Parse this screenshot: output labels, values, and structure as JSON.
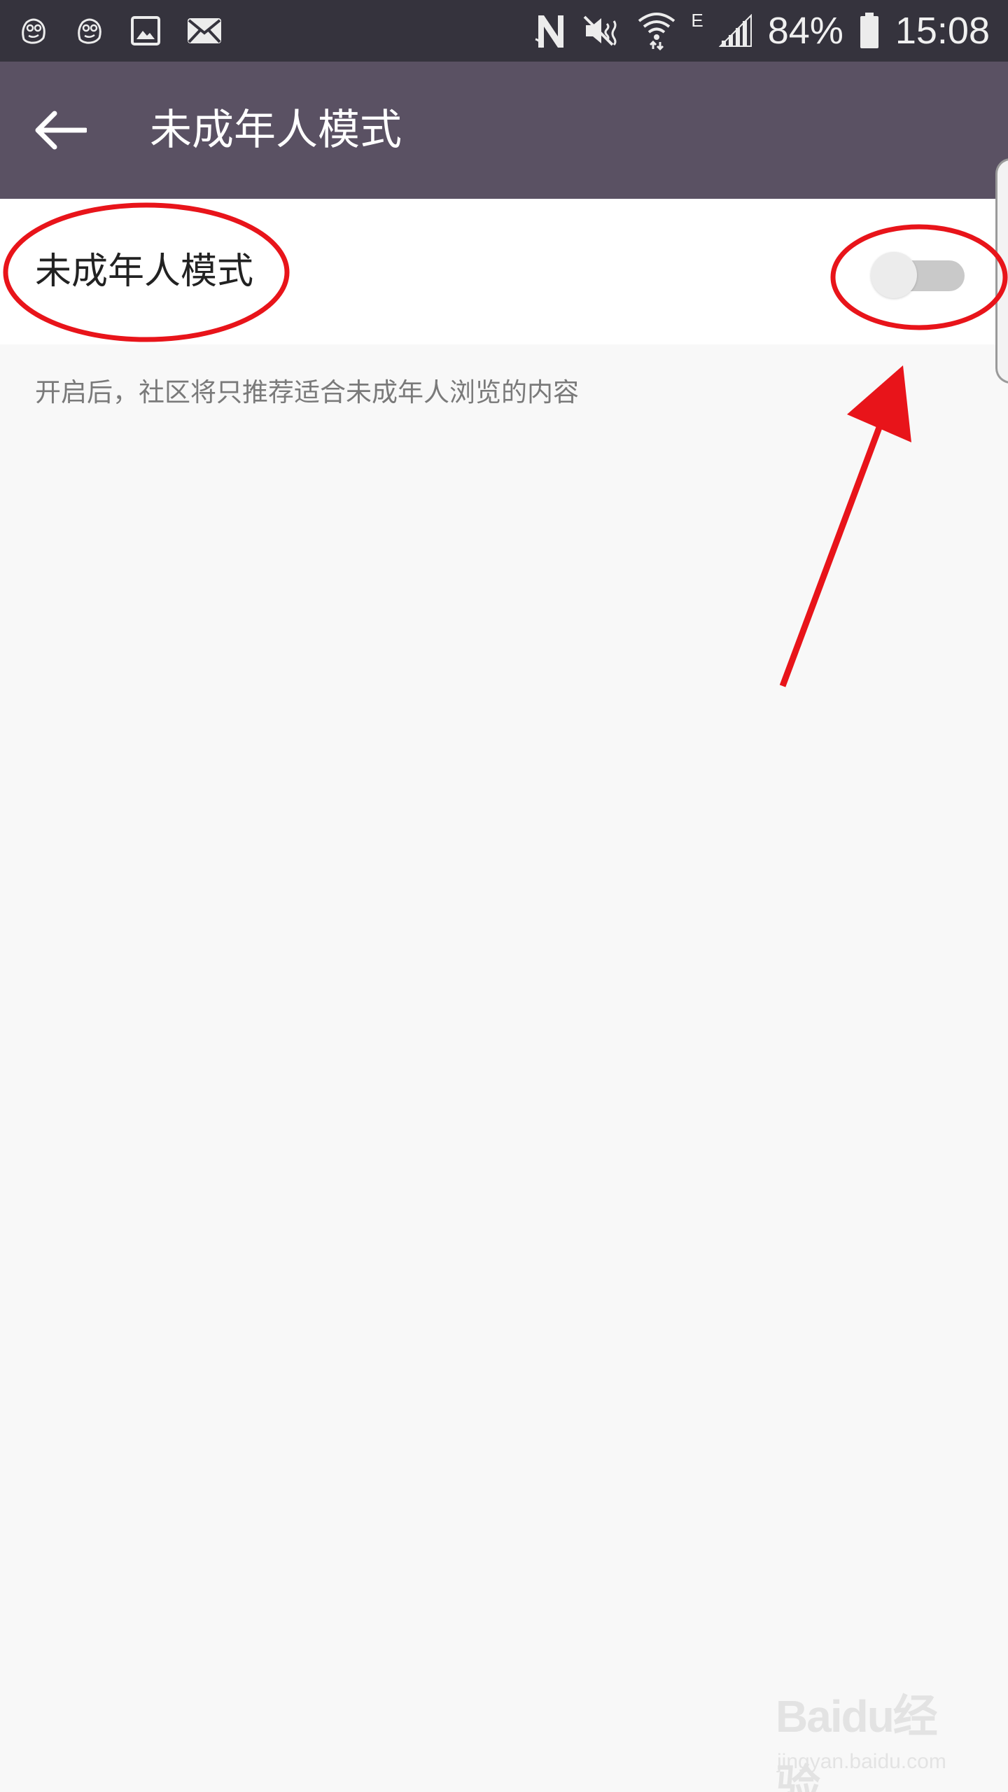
{
  "status_bar": {
    "battery": "84%",
    "time": "15:08",
    "network_type": "E",
    "left_icons": [
      "app-mascot-icon",
      "app-mascot-icon",
      "gallery-icon",
      "mail-icon"
    ],
    "right_icons": [
      "nfc-icon",
      "mute-icon",
      "wifi-icon",
      "signal-icon",
      "battery-icon"
    ]
  },
  "toolbar": {
    "title": "未成年人模式",
    "back_icon": "arrow-left-icon"
  },
  "setting": {
    "label": "未成年人模式",
    "enabled": false,
    "description": "开启后，社区将只推荐适合未成年人浏览的内容"
  },
  "annotations": {
    "color": "#e8141a"
  },
  "watermark": {
    "logo": "Baidu经验",
    "url": "jingyan.baidu.com"
  },
  "colors": {
    "status_bar": "#35333d",
    "toolbar": "#5a5163",
    "background": "#f8f8f8"
  }
}
